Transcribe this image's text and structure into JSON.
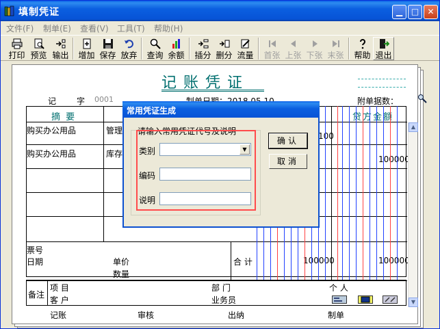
{
  "window": {
    "title": "填制凭证"
  },
  "menu": [
    {
      "label": "文件(F)"
    },
    {
      "label": "制单(E)"
    },
    {
      "label": "查看(V)"
    },
    {
      "label": "工具(T)"
    },
    {
      "label": "帮助(H)"
    }
  ],
  "toolbar": [
    {
      "label": "打印",
      "icon": "printer-icon",
      "enabled": true
    },
    {
      "label": "预览",
      "icon": "preview-icon",
      "enabled": true
    },
    {
      "label": "输出",
      "icon": "export-icon",
      "enabled": true
    },
    {
      "label": "增加",
      "icon": "add-icon",
      "enabled": true
    },
    {
      "label": "保存",
      "icon": "save-icon",
      "enabled": true
    },
    {
      "label": "放弃",
      "icon": "undo-icon",
      "enabled": true
    },
    {
      "label": "查询",
      "icon": "query-icon",
      "enabled": true
    },
    {
      "label": "余额",
      "icon": "balance-icon",
      "enabled": true
    },
    {
      "label": "插分",
      "icon": "insert-icon",
      "enabled": true
    },
    {
      "label": "删分",
      "icon": "delete-icon",
      "enabled": true
    },
    {
      "label": "流量",
      "icon": "cashflow-icon",
      "enabled": true
    },
    {
      "label": "首张",
      "icon": "first-icon",
      "enabled": false
    },
    {
      "label": "上张",
      "icon": "prev-icon",
      "enabled": false
    },
    {
      "label": "下张",
      "icon": "next-icon",
      "enabled": false
    },
    {
      "label": "末张",
      "icon": "last-icon",
      "enabled": false
    },
    {
      "label": "帮助",
      "icon": "help-icon",
      "enabled": true
    },
    {
      "label": "退出",
      "icon": "exit-icon",
      "enabled": true
    }
  ],
  "voucher": {
    "title": "记账凭证",
    "type_label": "记",
    "number_label": "字",
    "number_value": "0001",
    "date_label": "制单日期：2018.05.10",
    "attachments_label": "附单据数：",
    "col_summary": "摘  要",
    "col_credit": "贷方金额",
    "rows": [
      {
        "summary": "购买办公用品",
        "account": "管理",
        "debit": "100",
        "credit": ""
      },
      {
        "summary": "购买办公用品",
        "account": "库存",
        "debit": "",
        "credit": "100000"
      }
    ],
    "ticket_label": "票号",
    "date_field_label": "日期",
    "unit_price_label": "单价",
    "quantity_label": "数量",
    "total_label": "合 计",
    "total_debit": "100000",
    "total_credit": "100000",
    "notes_label": "备注",
    "project_label": "项   目",
    "department_label": "部   门",
    "person_label": "个   人",
    "customer_label": "客   户",
    "salesman_label": "业务员",
    "footer": {
      "bookkeeper": "记账",
      "reviewer": "审核",
      "cashier": "出纳",
      "maker": "制单"
    }
  },
  "dialog": {
    "title": "常用凭证生成",
    "group_label": "请输入常用凭证代号及说明",
    "category_label": "类别",
    "code_label": "编码",
    "description_label": "说明",
    "category_value": "",
    "code_value": "",
    "description_value": "",
    "ok_label": "确认",
    "cancel_label": "取消"
  }
}
